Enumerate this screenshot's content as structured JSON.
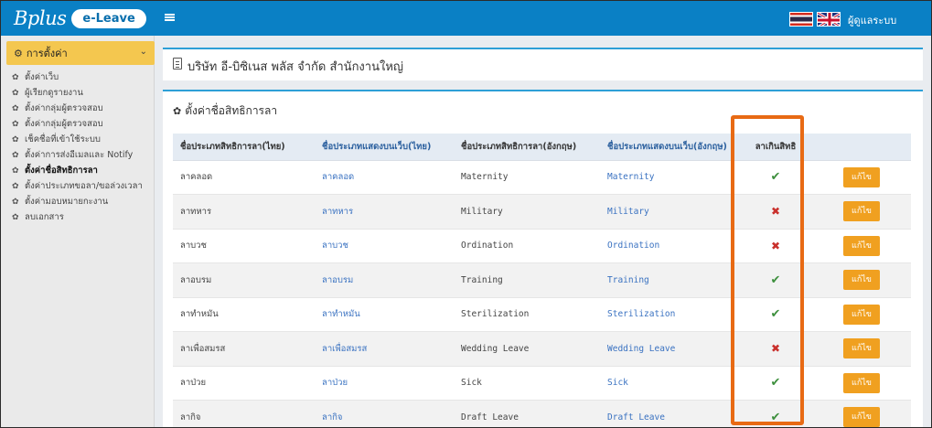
{
  "brand": {
    "script": "Bplus",
    "app": "e-Leave"
  },
  "header": {
    "user_link": "ผู้ดูแลระบบ"
  },
  "sidebar": {
    "section": "การตั้งค่า",
    "items": [
      {
        "label": "ตั้งค่าเว็บ"
      },
      {
        "label": "ผู้เรียกดูรายงาน"
      },
      {
        "label": "ตั้งค่ากลุ่มผู้ตรวจสอบ"
      },
      {
        "label": "ตั้งค่ากลุ่มผู้ตรวจสอบ"
      },
      {
        "label": "เช็คชื่อที่เข้าใช้ระบบ"
      },
      {
        "label": "ตั้งค่าการส่งอีเมลและ Notify"
      },
      {
        "label": "ตั้งค่าชื่อสิทธิการลา"
      },
      {
        "label": "ตั้งค่าประเภทขอลา/ขอล่วงเวลา"
      },
      {
        "label": "ตั้งค่ามอบหมายกะงาน"
      },
      {
        "label": "ลบเอกสาร"
      }
    ]
  },
  "company": {
    "title": "บริษัท อี-บิซิเนส พลัส จำกัด สำนักงานใหญ่"
  },
  "section": {
    "title": "ตั้งค่าชื่อสิทธิการลา"
  },
  "table": {
    "headers": [
      "ชื่อประเภทสิทธิการลา(ไทย)",
      "ชื่อประเภทแสดงบนเว็บ(ไทย)",
      "ชื่อประเภทสิทธิการลา(อังกฤษ)",
      "ชื่อประเภทแสดงบนเว็บ(อังกฤษ)",
      "ลาเกินสิทธิ",
      ""
    ],
    "edit_label": "แก้ไข",
    "rows": [
      {
        "th": "ลาคลอด",
        "th_web": "ลาคลอด",
        "en": "Maternity",
        "en_web": "Maternity",
        "over": true
      },
      {
        "th": "ลาทหาร",
        "th_web": "ลาทหาร",
        "en": "Military",
        "en_web": "Military",
        "over": false
      },
      {
        "th": "ลาบวช",
        "th_web": "ลาบวช",
        "en": "Ordination",
        "en_web": "Ordination",
        "over": false
      },
      {
        "th": "ลาอบรม",
        "th_web": "ลาอบรม",
        "en": "Training",
        "en_web": "Training",
        "over": true
      },
      {
        "th": "ลาทำหมัน",
        "th_web": "ลาทำหมัน",
        "en": "Sterilization",
        "en_web": "Sterilization",
        "over": true
      },
      {
        "th": "ลาเพื่อสมรส",
        "th_web": "ลาเพื่อสมรส",
        "en": "Wedding Leave",
        "en_web": "Wedding Leave",
        "over": false
      },
      {
        "th": "ลาป่วย",
        "th_web": "ลาป่วย",
        "en": "Sick",
        "en_web": "Sick",
        "over": true
      },
      {
        "th": "ลากิจ",
        "th_web": "ลากิจ",
        "en": "Draft Leave",
        "en_web": "Draft Leave",
        "over": true
      }
    ]
  },
  "colors": {
    "navbar": "#0a80c5",
    "accent_box": "#2d9fd6",
    "edit_button": "#f0a020",
    "highlight": "#e86a14",
    "check": "#3d8f3d",
    "cross": "#c9302c"
  }
}
